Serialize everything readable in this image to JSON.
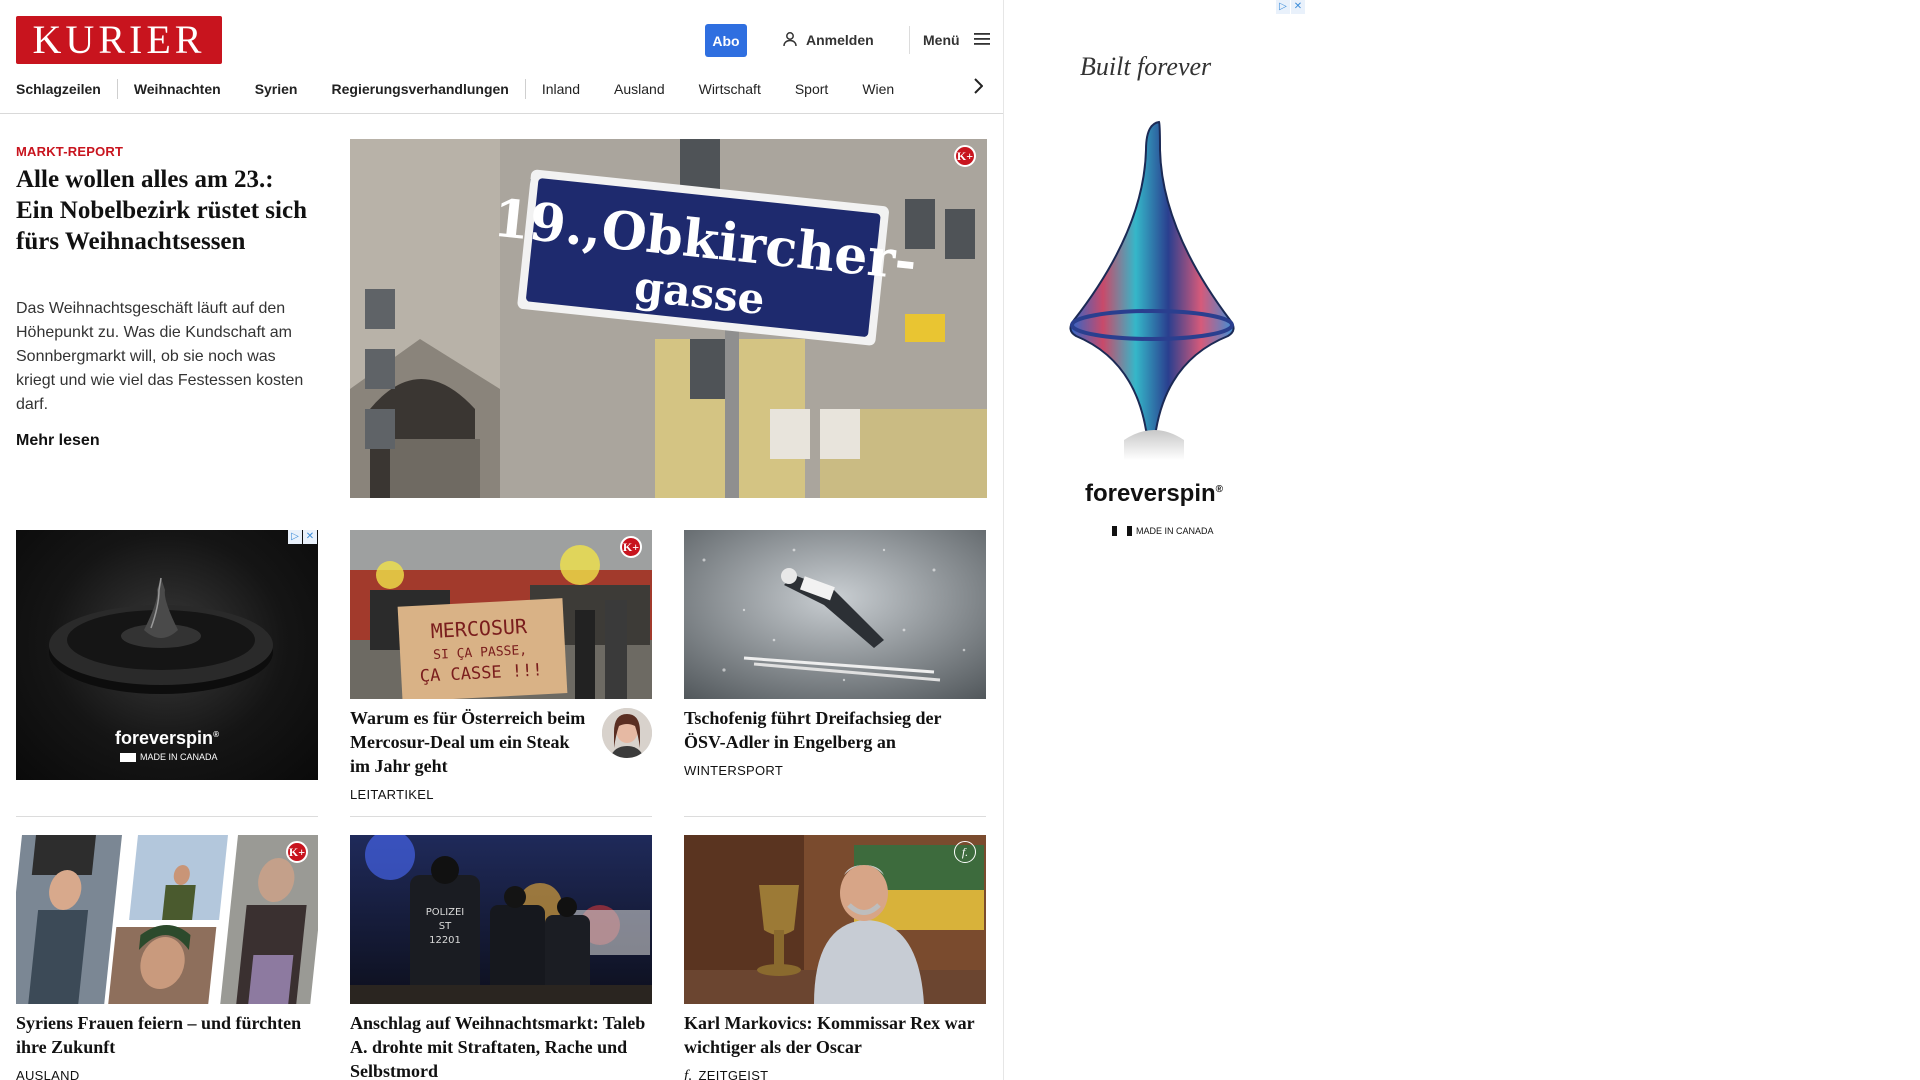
{
  "header": {
    "logo": "KURIER",
    "abo": "Abo",
    "login": "Anmelden",
    "menu": "Menü"
  },
  "nav": {
    "items": [
      "Schlagzeilen",
      "Weihnachten",
      "Syrien",
      "Regierungsverhandlungen",
      "Inland",
      "Ausland",
      "Wirtschaft",
      "Sport",
      "Wien"
    ]
  },
  "hero": {
    "kicker": "MARKT-REPORT",
    "title": "Alle wollen alles am 23.: Ein Nobelbezirk rüstet sich fürs Weihnachtsessen",
    "teaser": "Das Weihnachtsgeschäft läuft auf den Höhepunkt zu. Was die Kundschaft am Sonnbergmarkt will, ob sie noch was kriegt und wie viel das Festessen kosten darf.",
    "more": "Mehr lesen",
    "sign_line1": "19.,Obkircher-",
    "sign_line2": "gasse"
  },
  "badges": {
    "kplus": "K+"
  },
  "cards": [
    {
      "title": "Warum es für Österreich beim Mercosur-Deal um ein Steak im Jahr geht",
      "category": "LEITARTIKEL",
      "sign1": "MERCOSUR",
      "sign2": "SI ÇA PASSE,",
      "sign3": "ÇA CASSE !!!"
    },
    {
      "title": "Tschofenig führt Dreifachsieg der ÖSV-Adler in Engelberg an",
      "category": "WINTERSPORT"
    },
    {
      "title": "Syriens Frauen feiern – und fürch­ten ihre Zukunft",
      "category": "AUSLAND"
    },
    {
      "title": "Anschlag auf Weihnachtsmarkt: Taleb A. drohte mit Straftaten, Ra­che und Selbstmord",
      "category": "",
      "police1": "POLIZEI",
      "police2": "ST",
      "police3": "12201"
    },
    {
      "title": "Karl Markovics: Kommissar Rex war wichtiger als der Oscar",
      "category": "ZEITGEIST",
      "zeit_icon": "f."
    }
  ],
  "ads": {
    "brand": "foreverspin",
    "reg": "®",
    "made_in": "MADE IN CANADA",
    "tagline": "Built forever",
    "adchoices": "▷",
    "close": "✕"
  },
  "icons": {
    "user": "user-icon",
    "menu": "hamburger-icon",
    "next": "chevron-right-icon"
  },
  "colors": {
    "brand_red": "#c8141e",
    "abo_blue": "#2f6fe0"
  }
}
